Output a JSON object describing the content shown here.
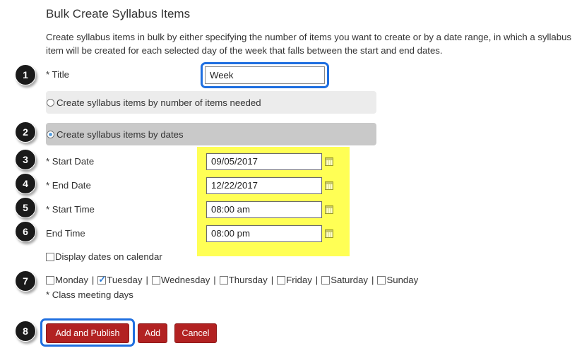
{
  "header": {
    "title": "Bulk Create Syllabus Items",
    "description": "Create syllabus items in bulk by either specifying the number of items you want to create or by a date range, in which a syllabus item will be created for each selected day of the week that falls between the start and end dates."
  },
  "steps": [
    "1",
    "2",
    "3",
    "4",
    "5",
    "6",
    "7",
    "8"
  ],
  "form": {
    "title_label": "* Title",
    "title_value": "Week",
    "option_number_label": "Create syllabus items by number of items needed",
    "option_dates_label": "Create syllabus items by dates",
    "start_date_label": "* Start Date",
    "start_date_value": "09/05/2017",
    "end_date_label": "* End Date",
    "end_date_value": "12/22/2017",
    "start_time_label": "* Start Time",
    "start_time_value": "08:00 am",
    "end_time_label": "End Time",
    "end_time_value": "08:00 pm",
    "display_calendar_label": "Display dates on calendar",
    "days": [
      "Monday",
      "Tuesday",
      "Wednesday",
      "Thursday",
      "Friday",
      "Saturday",
      "Sunday"
    ],
    "days_separator": "|",
    "class_meeting_label": "* Class meeting days"
  },
  "buttons": {
    "add_publish": "Add and Publish",
    "add": "Add",
    "cancel": "Cancel"
  },
  "colors": {
    "highlight_yellow": "#ffff55",
    "focus_blue": "#1f6fe0",
    "button_red": "#b22222"
  }
}
